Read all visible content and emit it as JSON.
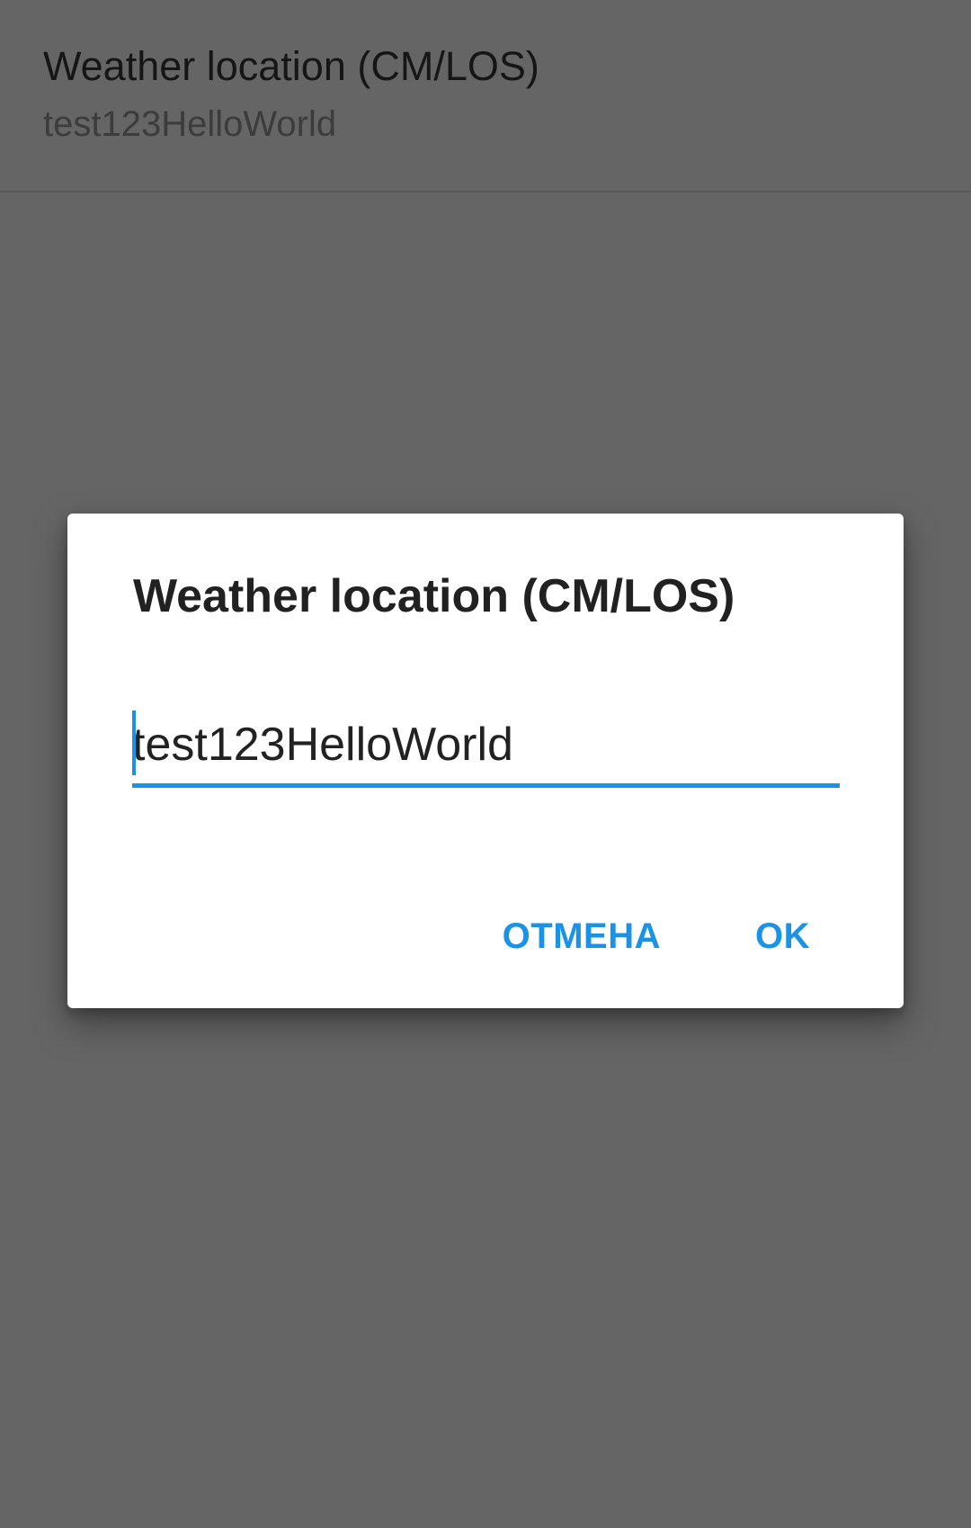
{
  "preference": {
    "title": "Weather location (CM/LOS)",
    "summary": "test123HelloWorld"
  },
  "dialog": {
    "title": "Weather location (CM/LOS)",
    "input_value": "test123HelloWorld",
    "cancel_label": "ОТМЕНА",
    "ok_label": "OK"
  },
  "colors": {
    "accent": "#1a93e6",
    "scrim_background": "#656565",
    "dialog_background": "#ffffff"
  }
}
